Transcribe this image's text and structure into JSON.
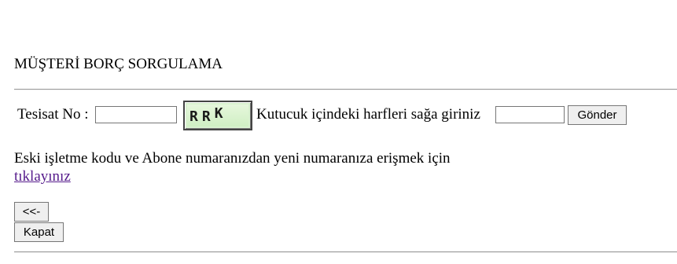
{
  "page": {
    "title": "MÜŞTERİ BORÇ SORGULAMA"
  },
  "form": {
    "tesisat_label": "Tesisat No :",
    "tesisat_value": "",
    "captcha_text_1": "R",
    "captcha_text_2": "R",
    "captcha_text_3": "K",
    "captcha_instruction": "Kutucuk içindeki harfleri sağa giriniz",
    "captcha_value": "",
    "submit_label": "Gönder"
  },
  "info": {
    "text": "Eski işletme kodu ve Abone numaranızdan yeni numaranıza erişmek için",
    "link_text": "tıklayınız"
  },
  "nav": {
    "back_label": "<<-",
    "close_label": "Kapat"
  },
  "colors": {
    "link": "#551a8b",
    "captcha_bg": "#d9f2d0",
    "rule": "#9a9a9a"
  }
}
